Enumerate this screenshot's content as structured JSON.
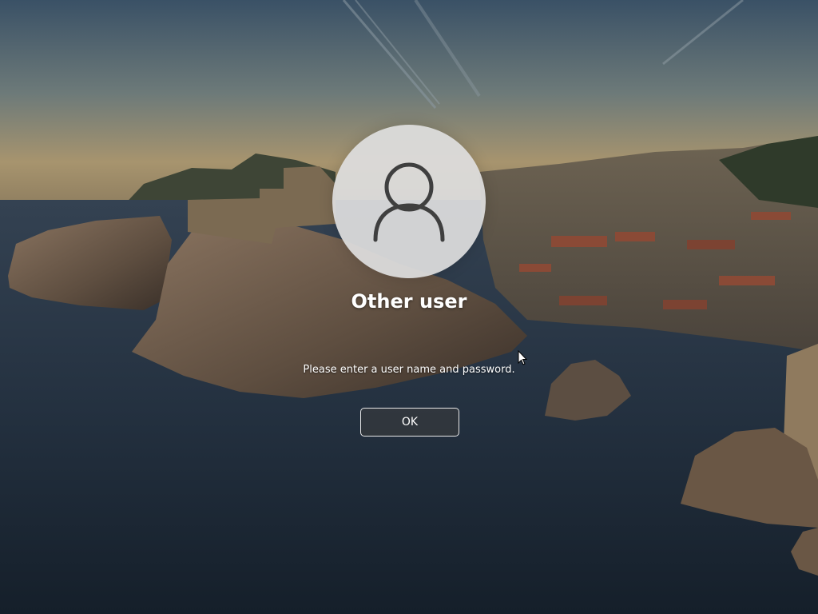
{
  "login": {
    "user_name": "Other user",
    "message": "Please enter a user name and password.",
    "ok_label": "OK"
  },
  "icons": {
    "avatar": "person-icon",
    "cursor": "mouse-pointer-icon"
  },
  "colors": {
    "text": "#ffffff",
    "avatar_background": "#dedede",
    "avatar_glyph": "#3f3f3f",
    "button_border": "#e8e8e8"
  }
}
